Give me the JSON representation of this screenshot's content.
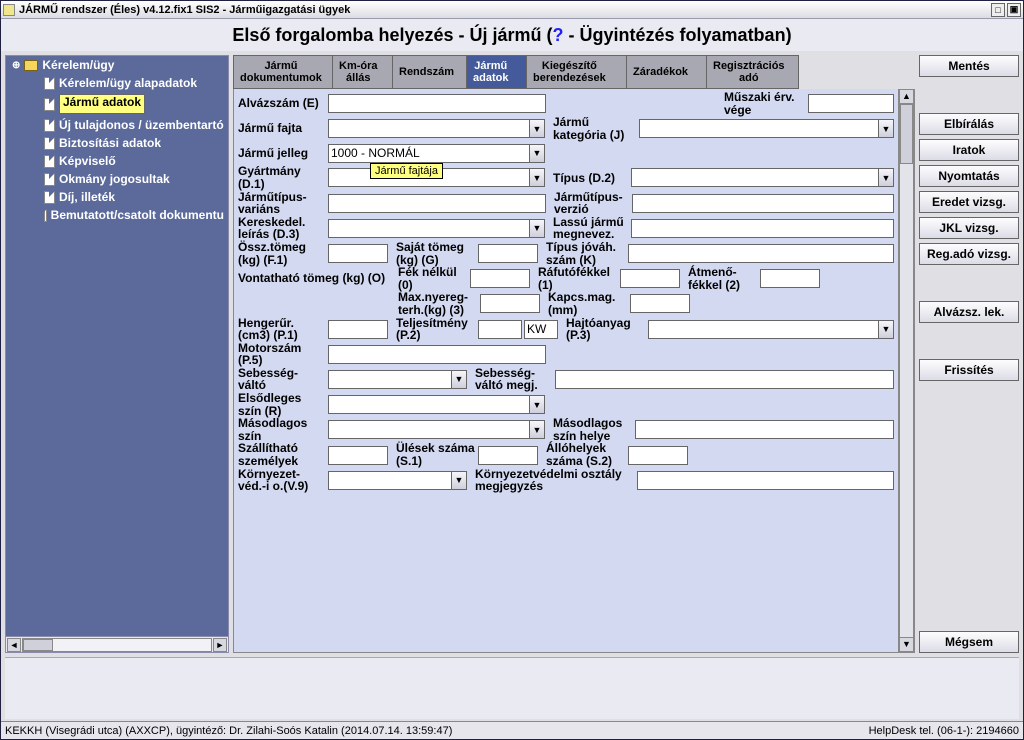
{
  "titlebar": {
    "text": "JÁRMŰ rendszer (Éles) v4.12.fix1 SIS2 - Járműigazgatási ügyek"
  },
  "subtitle": {
    "t1": "Első forgalomba helyezés - Új jármű (",
    "q": "?",
    "t2": " - Ügyintézés folyamatban)"
  },
  "tree": {
    "root": "Kérelem/ügy",
    "items": [
      "Kérelem/ügy alapadatok",
      "Jármű adatok",
      "Új tulajdonos / üzembentartó",
      "Biztosítási adatok",
      "Képviselő",
      "Okmány jogosultak",
      "Díj, illeték",
      "Bemutatott/csatolt dokumentu"
    ],
    "selected_index": 1
  },
  "tabs": [
    {
      "l1": "Jármű",
      "l2": "dokumentumok"
    },
    {
      "l1": "Km-óra",
      "l2": "állás"
    },
    {
      "l1": "Rendszám",
      "l2": ""
    },
    {
      "l1": "Jármű",
      "l2": "adatok"
    },
    {
      "l1": "Kiegészítő",
      "l2": "berendezések"
    },
    {
      "l1": "Záradékok",
      "l2": ""
    },
    {
      "l1": "Regisztrációs",
      "l2": "adó"
    }
  ],
  "active_tab": 3,
  "form": {
    "alvazszam": "Alvázszám (E)",
    "muszaki_erv": "Műszaki érv. vége",
    "jarmu_fajta": "Jármű fajta",
    "jarmu_kategoria": "Jármű kategória (J)",
    "jarmu_jelleg": "Jármű jelleg",
    "jarmu_jelleg_val": "1000 - NORMÁL",
    "gyartmany": "Gyártmány (D.1)",
    "tipus": "Típus (D.2)",
    "jarmutipus_varians": "Járműtípus-variáns",
    "jarmutipus_verzio": "Járműtípus-verzió",
    "kereskedel": "Kereskedel. leírás (D.3)",
    "lassu": "Lassú jármű megnevez.",
    "ossztomeg": "Össz.tömeg (kg) (F.1)",
    "sajattomeg": "Saját tömeg (kg) (G)",
    "tipus_jovah": "Típus jóváh. szám (K)",
    "vontathato": "Vontatható tömeg (kg) (O)",
    "fek_nelkul": "Fék nélkül (0)",
    "rafutofek": "Ráfutófékkel (1)",
    "atmenofek": "Átmenő-fékkel (2)",
    "max_nyereg": "Max.nyereg-terh.(kg) (3)",
    "kapcs": "Kapcs.mag. (mm)",
    "hengerur": "Hengerűr. (cm3) (P.1)",
    "teljesitmeny": "Teljesítmény (P.2)",
    "kw": "KW",
    "hajtoanyag": "Hajtóanyag (P.3)",
    "motorszam": "Motorszám (P.5)",
    "sebessegvalto": "Sebesség-váltó",
    "sebessegvalto_megj": "Sebesség-váltó megj.",
    "elsodleges_szin": "Elsődleges szín (R)",
    "masodlagos_szin": "Másodlagos szín",
    "masodlagos_szin_helye": "Másodlagos szín helye",
    "szallithato": "Szállítható személyek",
    "ulesek": "Ülések száma (S.1)",
    "allohelyek": "Állóhelyek száma (S.2)",
    "kornyezet": "Környezet-véd.-i o.(V.9)",
    "kornyezet_megj": "Környezetvédelmi osztály megjegyzés"
  },
  "tooltip": "Jármű fajtája",
  "actions": {
    "mentes": "Mentés",
    "elbiralas": "Elbírálás",
    "iratok": "Iratok",
    "nyomtatas": "Nyomtatás",
    "eredet": "Eredet vizsg.",
    "jkl": "JKL vizsg.",
    "regado": "Reg.adó vizsg.",
    "alvazsz": "Alvázsz. lek.",
    "frissites": "Frissítés",
    "megsem": "Mégsem"
  },
  "status": {
    "left": "KEKKH (Visegrádi utca) (AXXCP), ügyintéző: Dr. Zilahi-Soós Katalin (2014.07.14. 13:59:47)",
    "right": "HelpDesk tel. (06-1-): 2194660"
  }
}
